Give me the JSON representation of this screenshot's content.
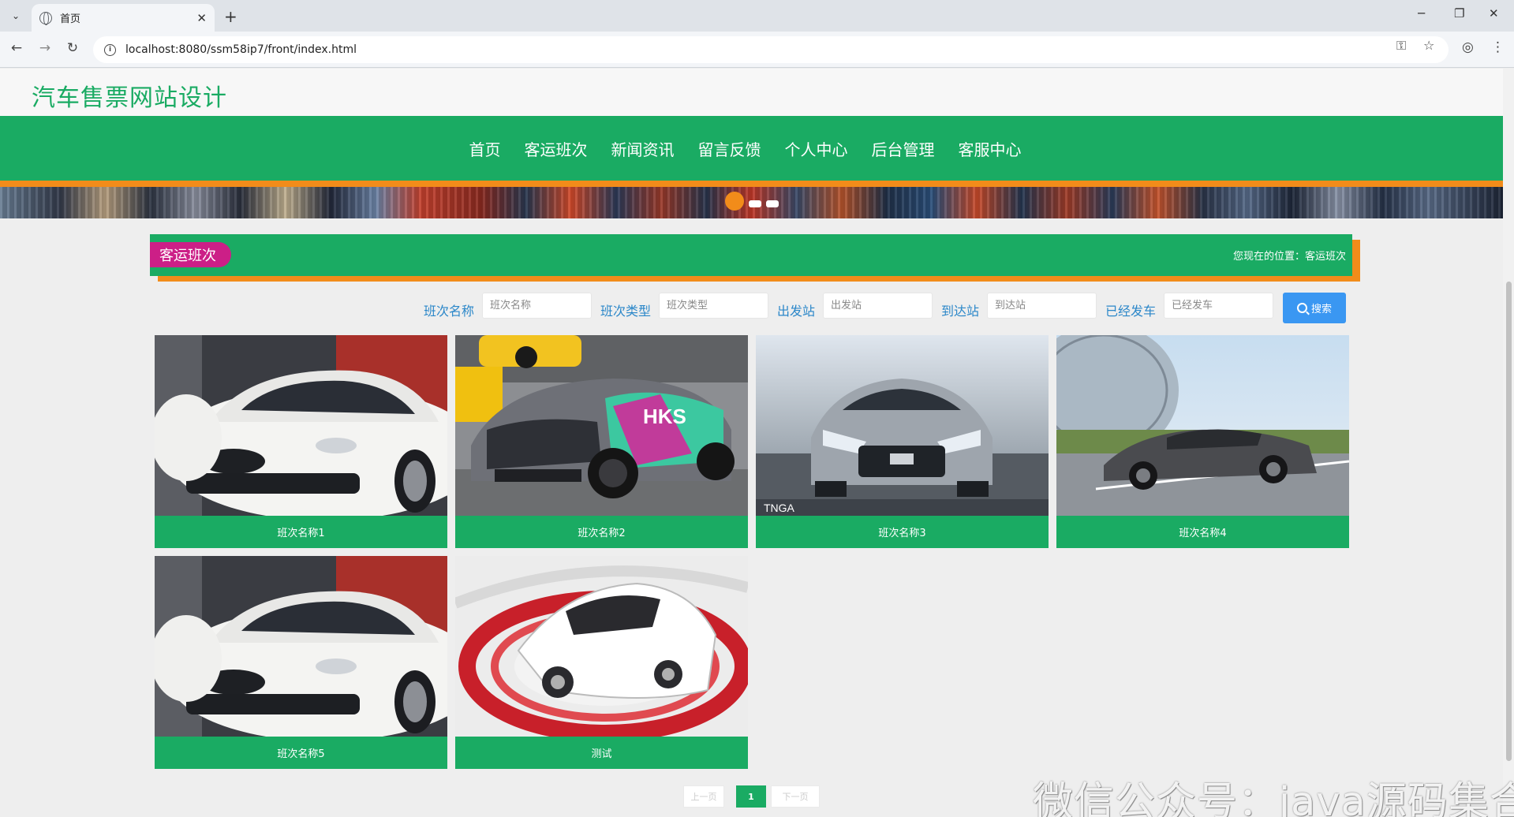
{
  "browser": {
    "tab_title": "首页",
    "tab_close": "✕",
    "new_tab": "+",
    "url": "localhost:8080/ssm58ip7/front/index.html",
    "minimize": "─",
    "restore": "❐",
    "close": "✕",
    "back": "←",
    "forward": "→",
    "reload": "↻",
    "info": "i",
    "tab_list": "⌄",
    "key_icon": "key-icon",
    "star": "☆",
    "profile": "◎",
    "menu": "⋮",
    "key": "⚿"
  },
  "site": {
    "title": "汽车售票网站设计",
    "nav": [
      "首页",
      "客运班次",
      "新闻资讯",
      "留言反馈",
      "个人中心",
      "后台管理",
      "客服中心"
    ]
  },
  "section": {
    "title": "客运班次",
    "breadcrumb": "您现在的位置：客运班次"
  },
  "search": {
    "fields": [
      {
        "label": "班次名称",
        "placeholder": "班次名称"
      },
      {
        "label": "班次类型",
        "placeholder": "班次类型"
      },
      {
        "label": "出发站",
        "placeholder": "出发站"
      },
      {
        "label": "到达站",
        "placeholder": "到达站"
      },
      {
        "label": "已经发车",
        "placeholder": "已经发车"
      }
    ],
    "button": "搜索"
  },
  "cards": [
    {
      "name": "班次名称1"
    },
    {
      "name": "班次名称2"
    },
    {
      "name": "班次名称3"
    },
    {
      "name": "班次名称4"
    },
    {
      "name": "班次名称5"
    },
    {
      "name": "测试"
    }
  ],
  "pagination": {
    "prev": "上一页",
    "current": "1",
    "next": "下一页"
  },
  "watermark": "微信公众号：java源码集合",
  "colors": {
    "primary_green": "#1aab63",
    "orange": "#f28c1a",
    "badge_magenta": "#cc1f87",
    "label_blue": "#2b87c9",
    "button_blue": "#3a97f2"
  }
}
